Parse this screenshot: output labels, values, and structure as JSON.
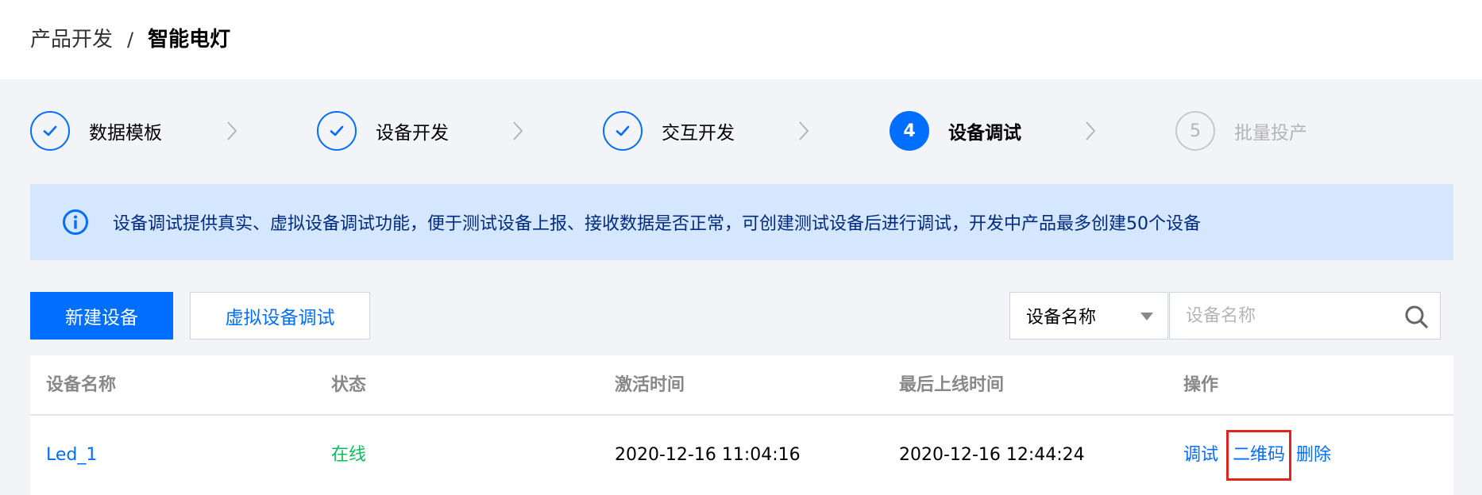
{
  "breadcrumb": {
    "parent": "产品开发",
    "separator": "/",
    "current": "智能电灯"
  },
  "steps": [
    {
      "index": "1",
      "label": "数据模板",
      "state": "done",
      "icon": "check-icon"
    },
    {
      "index": "2",
      "label": "设备开发",
      "state": "done",
      "icon": "check-icon"
    },
    {
      "index": "3",
      "label": "交互开发",
      "state": "done",
      "icon": "check-icon"
    },
    {
      "index": "4",
      "label": "设备调试",
      "state": "active"
    },
    {
      "index": "5",
      "label": "批量投产",
      "state": "todo"
    }
  ],
  "banner": {
    "icon": "info-icon",
    "text": "设备调试提供真实、虚拟设备调试功能，便于测试设备上报、接收数据是否正常，可创建测试设备后进行调试，开发中产品最多创建50个设备"
  },
  "toolbar": {
    "new_device_label": "新建设备",
    "virtual_debug_label": "虚拟设备调试",
    "filter_selected": "设备名称",
    "search_placeholder": "设备名称",
    "search_value": ""
  },
  "table": {
    "columns": [
      "设备名称",
      "状态",
      "激活时间",
      "最后上线时间",
      "操作"
    ],
    "rows": [
      {
        "name": "Led_1",
        "status": "在线",
        "activated": "2020-12-16 11:04:16",
        "last_online": "2020-12-16 12:44:24",
        "actions": [
          "调试",
          "二维码",
          "删除"
        ]
      }
    ]
  },
  "colors": {
    "primary": "#006eff",
    "online": "#0abf5b",
    "banner_bg": "#d5e7ff",
    "highlight": "#e0241e"
  }
}
